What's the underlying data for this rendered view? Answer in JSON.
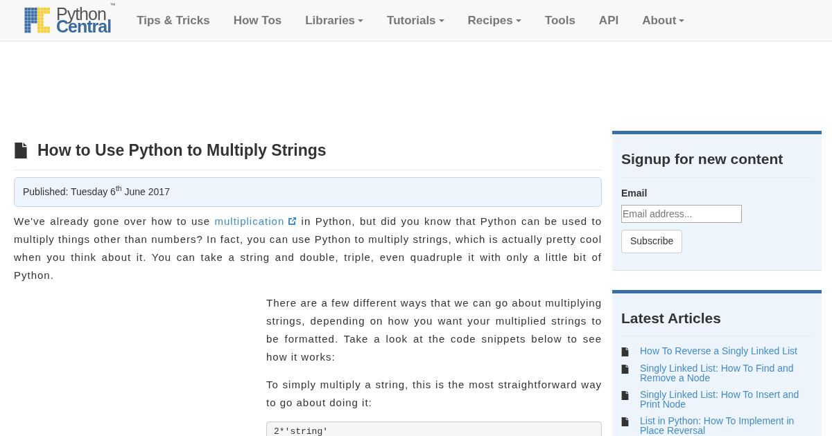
{
  "logo": {
    "line_1": "Python",
    "line_2": "Central",
    "mark": "™"
  },
  "nav": [
    {
      "label": "Tips & Tricks",
      "has_menu": false
    },
    {
      "label": "How Tos",
      "has_menu": false
    },
    {
      "label": "Libraries",
      "has_menu": true
    },
    {
      "label": "Tutorials",
      "has_menu": true
    },
    {
      "label": "Recipes",
      "has_menu": true
    },
    {
      "label": "Tools",
      "has_menu": false
    },
    {
      "label": "API",
      "has_menu": false
    },
    {
      "label": "About",
      "has_menu": true
    }
  ],
  "article": {
    "title": "How to Use Python to Multiply Strings",
    "published": "Published: Tuesday 6$^{th}$ June 2017",
    "intro": {
      "before": "We've already gone over how to use",
      "link": "multiplication",
      "after": "in Python, but did you know that Python can be used to multiply things other than numbers? In fact, you can use Python to multiply strings, which is actually pretty cool when you think about it. You can take a string and double, triple, even quadruple it with only a little bit of Python."
    },
    "paragraphs": [
      "There are a few different ways that we can go about multiplying strings, depending on how you want your multiplied strings to be formatted. Take a look at the code snippets below to see how it works:",
      "To simply multiply a string, this is the most straightforward way to go about doing it:"
    ],
    "code": "2*'string'"
  },
  "signup": {
    "title": "Signup for new content",
    "label": "Email",
    "placeholder": "Email address...",
    "button": "Subscribe"
  },
  "latest": {
    "title": "Latest Articles",
    "items": [
      "How To Reverse a Singly Linked List",
      "Singly Linked List: How To Find and Remove a Node",
      "Singly Linked List: How To Insert and Print Node",
      "List in Python: How To Implement in Place Reversal"
    ]
  }
}
